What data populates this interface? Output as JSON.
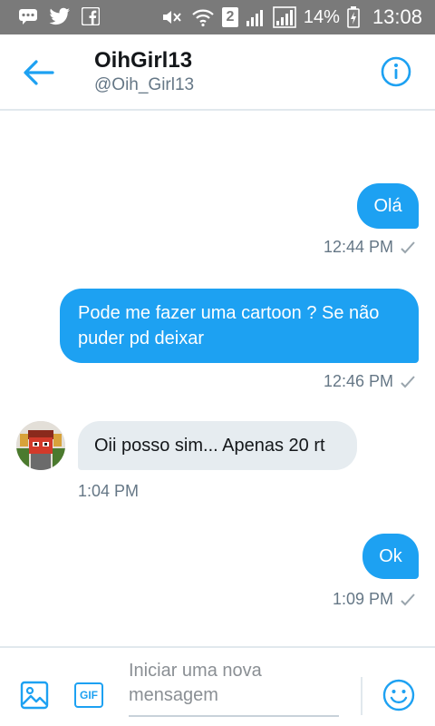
{
  "status_bar": {
    "battery_percent": "14%",
    "time": "13:08",
    "sim_number": "2"
  },
  "header": {
    "name": "OihGirl13",
    "handle": "@Oih_Girl13"
  },
  "messages": [
    {
      "text": "Olá",
      "time": "12:44 PM",
      "direction": "sent"
    },
    {
      "text": "Pode me fazer uma cartoon ? Se não puder pd deixar",
      "time": "12:46 PM",
      "direction": "sent"
    },
    {
      "text": "Oii posso sim... Apenas 20 rt",
      "time": "1:04 PM",
      "direction": "received"
    },
    {
      "text": "Ok",
      "time": "1:09 PM",
      "direction": "sent"
    }
  ],
  "composer": {
    "placeholder": "Iniciar uma nova mensagem",
    "gif_label": "GIF"
  },
  "colors": {
    "accent": "#1da1f2",
    "status_bar": "#7a7a7a",
    "received_bubble": "#e6ecf0"
  }
}
